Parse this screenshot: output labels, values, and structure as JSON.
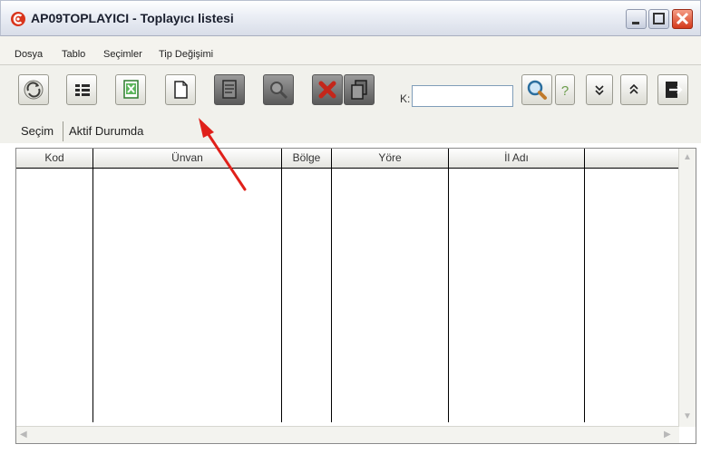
{
  "window": {
    "title": "AP09TOPLAYICI - Toplayıcı listesi",
    "title_icon": "app-logo-icon",
    "accent_color": "#d9341b"
  },
  "menu": {
    "items": [
      "Dosya",
      "Tablo",
      "Seçimler",
      "Tip Değişimi"
    ]
  },
  "toolbar": {
    "buttons": [
      {
        "icon": "refresh-icon"
      },
      {
        "icon": "list-icon"
      },
      {
        "icon": "excel-icon"
      },
      {
        "icon": "new-document-icon"
      },
      {
        "icon": "edit-document-icon",
        "disabled": true
      },
      {
        "icon": "search-icon",
        "disabled": true
      },
      {
        "icon": "delete-icon",
        "disabled": true
      },
      {
        "icon": "copy-icon",
        "disabled": true
      },
      {
        "icon": "magnifier-icon"
      },
      {
        "icon": "help-icon"
      },
      {
        "icon": "double-chevron-down-icon"
      },
      {
        "icon": "double-chevron-up-icon"
      },
      {
        "icon": "exit-icon"
      }
    ],
    "search_label": "K:",
    "search_value": ""
  },
  "tabs": {
    "items": [
      "Seçim",
      "Aktif Durumda"
    ]
  },
  "table": {
    "columns": [
      "Kod",
      "Ünvan",
      "Bölge",
      "Yöre",
      "İl Adı",
      ""
    ],
    "rows": []
  }
}
